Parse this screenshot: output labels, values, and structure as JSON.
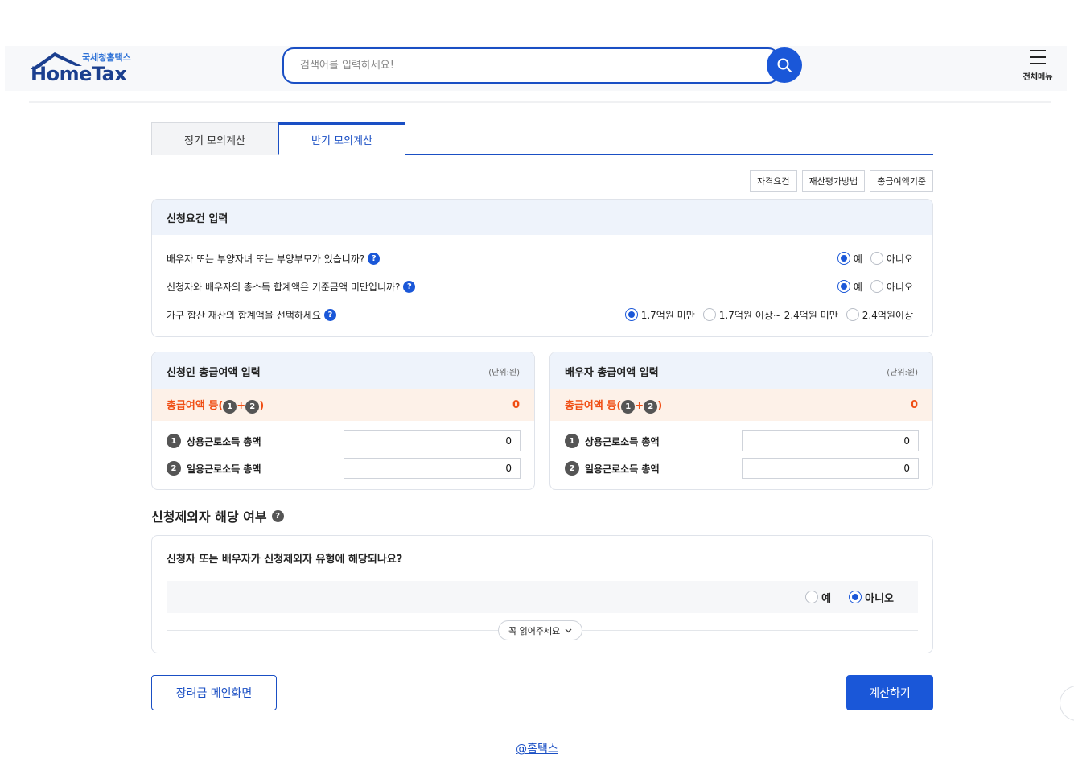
{
  "header": {
    "logo_sub": "국세청홈택스",
    "logo_main": "HomeTax",
    "search_placeholder": "검색어를 입력하세요!",
    "menu_label": "전체메뉴"
  },
  "tabs": [
    {
      "label": "정기 모의계산",
      "active": false
    },
    {
      "label": "반기 모의계산",
      "active": true
    }
  ],
  "info_buttons": [
    "자격요건",
    "재산평가방법",
    "총급여액기준"
  ],
  "requirements": {
    "title": "신청요건 입력",
    "questions": [
      {
        "text": "배우자 또는 부양자녀 또는 부양부모가 있습니까?",
        "options": [
          "예",
          "아니오"
        ],
        "selected": 0
      },
      {
        "text": "신청자와 배우자의 총소득 합계액은 기준금액 미만입니까?",
        "options": [
          "예",
          "아니오"
        ],
        "selected": 0
      },
      {
        "text": "가구 합산 재산의 합계액을 선택하세요",
        "options": [
          "1.7억원 미만",
          "1.7억원 이상~ 2.4억원 미만",
          "2.4억원이상"
        ],
        "selected": 0
      }
    ]
  },
  "applicant": {
    "title": "신청인 총급여액 입력",
    "unit": "(단위:원)",
    "total_label": "총급여액 등(",
    "total_label_end": ")",
    "plus": "+",
    "total_value": "0",
    "rows": [
      {
        "num": "1",
        "label": "상용근로소득 총액",
        "value": "0"
      },
      {
        "num": "2",
        "label": "일용근로소득 총액",
        "value": "0"
      }
    ]
  },
  "spouse": {
    "title": "배우자 총급여액 입력",
    "unit": "(단위:원)",
    "total_label": "총급여액 등(",
    "total_label_end": ")",
    "plus": "+",
    "total_value": "0",
    "rows": [
      {
        "num": "1",
        "label": "상용근로소득 총액",
        "value": "0"
      },
      {
        "num": "2",
        "label": "일용근로소득 총액",
        "value": "0"
      }
    ]
  },
  "exclusion": {
    "title": "신청제외자 해당 여부",
    "question": "신청자 또는 배우자가 신청제외자 유형에 해당되나요?",
    "options": [
      "예",
      "아니오"
    ],
    "selected": 1,
    "read_more": "꼭 읽어주세요"
  },
  "buttons": {
    "main": "장려금 메인화면",
    "calc": "계산하기"
  },
  "footer": "@홈택스",
  "colors": {
    "accent": "#1a57d8",
    "total_text": "#f04e14",
    "total_bg": "#fdf1e8",
    "panel_head_bg": "#eef3fb"
  }
}
